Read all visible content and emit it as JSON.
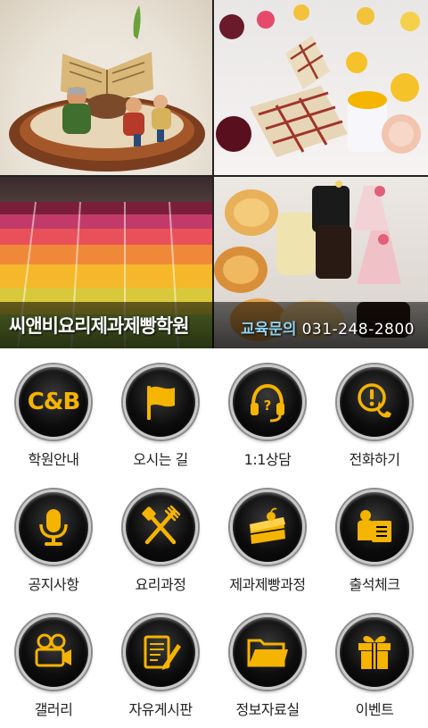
{
  "banner": {
    "academy_name": "씨앤비요리제과제빵학원",
    "contact_label": "교육문의",
    "contact_phone": "031-248-2800"
  },
  "menu": {
    "items": [
      {
        "label": "학원안내",
        "icon": "cb-logo-icon",
        "icon_text": "C&B"
      },
      {
        "label": "오시는 길",
        "icon": "flag-icon"
      },
      {
        "label": "1:1상담",
        "icon": "headset-icon"
      },
      {
        "label": "전화하기",
        "icon": "phone-call-icon"
      },
      {
        "label": "공지사항",
        "icon": "microphone-icon"
      },
      {
        "label": "요리과정",
        "icon": "cooking-utensils-icon"
      },
      {
        "label": "제과제빵과정",
        "icon": "cake-icon"
      },
      {
        "label": "출석체크",
        "icon": "attendance-icon"
      },
      {
        "label": "갤러리",
        "icon": "video-camera-icon"
      },
      {
        "label": "자유게시판",
        "icon": "notepad-pencil-icon"
      },
      {
        "label": "정보자료실",
        "icon": "folder-icon"
      },
      {
        "label": "이벤트",
        "icon": "gift-icon"
      }
    ]
  },
  "colors": {
    "icon_accent": "#f5b400",
    "contact_label": "#8fd2f2",
    "button_bg": "#000000"
  }
}
